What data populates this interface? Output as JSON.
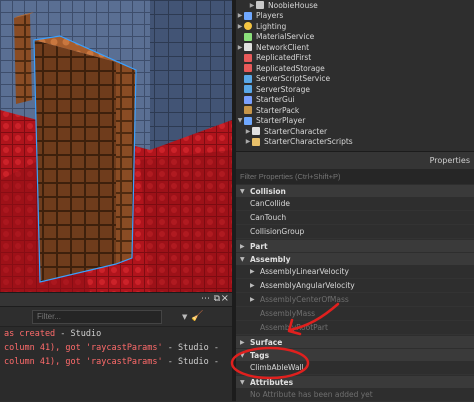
{
  "explorer": {
    "items": [
      {
        "label": "NoobieHouse",
        "icon": "model-icon",
        "color": "#c9c9c9",
        "indent": 2
      },
      {
        "label": "Players",
        "icon": "players-icon",
        "color": "#6fa8ff",
        "indent": 0
      },
      {
        "label": "Lighting",
        "icon": "lighting-icon",
        "color": "#f5c542",
        "indent": 0
      },
      {
        "label": "MaterialService",
        "icon": "material-icon",
        "color": "#8be07c",
        "indent": 0
      },
      {
        "label": "NetworkClient",
        "icon": "network-icon",
        "color": "#e0e0e0",
        "indent": 0
      },
      {
        "label": "ReplicatedFirst",
        "icon": "replicated-first-icon",
        "color": "#e85a5a",
        "indent": 0
      },
      {
        "label": "ReplicatedStorage",
        "icon": "replicated-storage-icon",
        "color": "#e85a5a",
        "indent": 0
      },
      {
        "label": "ServerScriptService",
        "icon": "server-script-icon",
        "color": "#5aa8e8",
        "indent": 0
      },
      {
        "label": "ServerStorage",
        "icon": "server-storage-icon",
        "color": "#5aa8e8",
        "indent": 0
      },
      {
        "label": "StarterGui",
        "icon": "starter-gui-icon",
        "color": "#7aa0ff",
        "indent": 0
      },
      {
        "label": "StarterPack",
        "icon": "starter-pack-icon",
        "color": "#c7964a",
        "indent": 0
      },
      {
        "label": "StarterPlayer",
        "icon": "starter-player-icon",
        "color": "#6fa8ff",
        "indent": 0
      },
      {
        "label": "StarterCharacter",
        "icon": "starter-character-icon",
        "color": "#e0e0e0",
        "indent": 1
      },
      {
        "label": "StarterCharacterScripts",
        "icon": "folder-icon",
        "color": "#e8c06a",
        "indent": 1
      }
    ]
  },
  "properties": {
    "panel_title": "Properties",
    "filter_placeholder": "Filter Properties (Ctrl+Shift+P)",
    "sections": [
      {
        "label": "Collision",
        "rows": [
          "CanCollide",
          "CanTouch",
          "CollisionGroup"
        ]
      },
      {
        "label": "Part",
        "rows": []
      },
      {
        "label": "Assembly",
        "rows": [
          "AssemblyLinearVelocity",
          "AssemblyAngularVelocity",
          "AssemblyCenterOfMass",
          "AssemblyMass",
          "AssemblyRootPart"
        ]
      },
      {
        "label": "Surface",
        "rows": []
      },
      {
        "label": "Tags",
        "rows": [
          "ClimbAbleWall"
        ]
      },
      {
        "label": "Attributes",
        "rows": [
          "No Attribute has been added yet"
        ]
      }
    ]
  },
  "output": {
    "filter_placeholder": "Filter...",
    "lines": [
      {
        "red": "as created",
        "gray": "  -  Studio"
      },
      {
        "red": " column 41), got 'raycastParams'",
        "gray": "  -  Studio  -"
      },
      {
        "red": " column 41), got 'raycastParams'",
        "gray": "  -  Studio  -"
      }
    ]
  },
  "annotation": {
    "color": "#e0201e"
  }
}
